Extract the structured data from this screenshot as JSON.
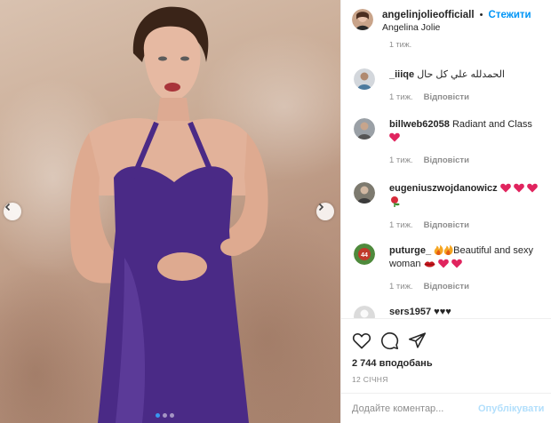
{
  "header": {
    "username": "angelinjolieofficiall",
    "separator": "•",
    "follow_label": "Стежити",
    "subtitle": "Angelina Jolie"
  },
  "photo": {
    "alt": "Angelina Jolie",
    "slide_count": 3,
    "active_slide": 1,
    "background_color": "#c9ab95",
    "dress_color": "#4a2a86"
  },
  "comments": {
    "cut_off_time": "1 тиж.",
    "items": [
      {
        "username": "_iiiqe",
        "text": "الحمدلله علي كل حال",
        "time": "1 тиж.",
        "reply_label": "Відповісти",
        "emoji": []
      },
      {
        "username": "billweb62058",
        "text": "Radiant and Class",
        "time": "1 тиж.",
        "reply_label": "Відповісти",
        "emoji": [
          "red-heart"
        ]
      },
      {
        "username": "eugeniuszwojdanowicz",
        "text": "",
        "time": "1 тиж.",
        "reply_label": "Відповісти",
        "emoji": [
          "red-heart",
          "red-heart",
          "red-heart",
          "rose"
        ]
      },
      {
        "username": "puturge_",
        "text": "Beautiful and sexy woman",
        "time": "1 тиж.",
        "reply_label": "Відповісти",
        "emoji": [
          "fire",
          "fire",
          "lips",
          "heart",
          "heart"
        ]
      },
      {
        "username": "sers1957",
        "text": "♥♥♥",
        "time": "",
        "reply_label": "",
        "emoji": []
      }
    ]
  },
  "actions": {
    "likes": "2 744 вподобань",
    "date": "12 СІЧНЯ"
  },
  "add_comment": {
    "placeholder": "Додайте коментар...",
    "post_label": "Опублікувати"
  },
  "colors": {
    "link_blue": "#0095f6",
    "muted_gray": "#8e8e8e",
    "post_disabled": "#b2dffc",
    "heart_red": "#e0245e"
  }
}
